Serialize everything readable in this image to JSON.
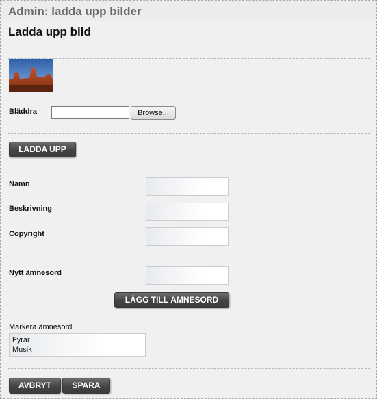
{
  "window": {
    "title": "Admin: ladda upp bilder"
  },
  "page": {
    "heading": "Ladda upp bild"
  },
  "upload": {
    "browse_label": "Bläddra",
    "browse_button": "Browse...",
    "file_value": "",
    "upload_button": "LADDA UPP"
  },
  "form": {
    "name_label": "Namn",
    "name_value": "",
    "description_label": "Beskrivning",
    "description_value": "",
    "copyright_label": "Copyright",
    "copyright_value": "",
    "new_keyword_label": "Nytt ämnesord",
    "new_keyword_value": "",
    "add_keyword_button": "LÄGG TILL ÄMNESORD",
    "mark_keywords_label": "Markera ämnesord",
    "keywords": [
      "Fyrar",
      "Musik"
    ]
  },
  "actions": {
    "cancel": "AVBRYT",
    "save": "SPARA"
  }
}
